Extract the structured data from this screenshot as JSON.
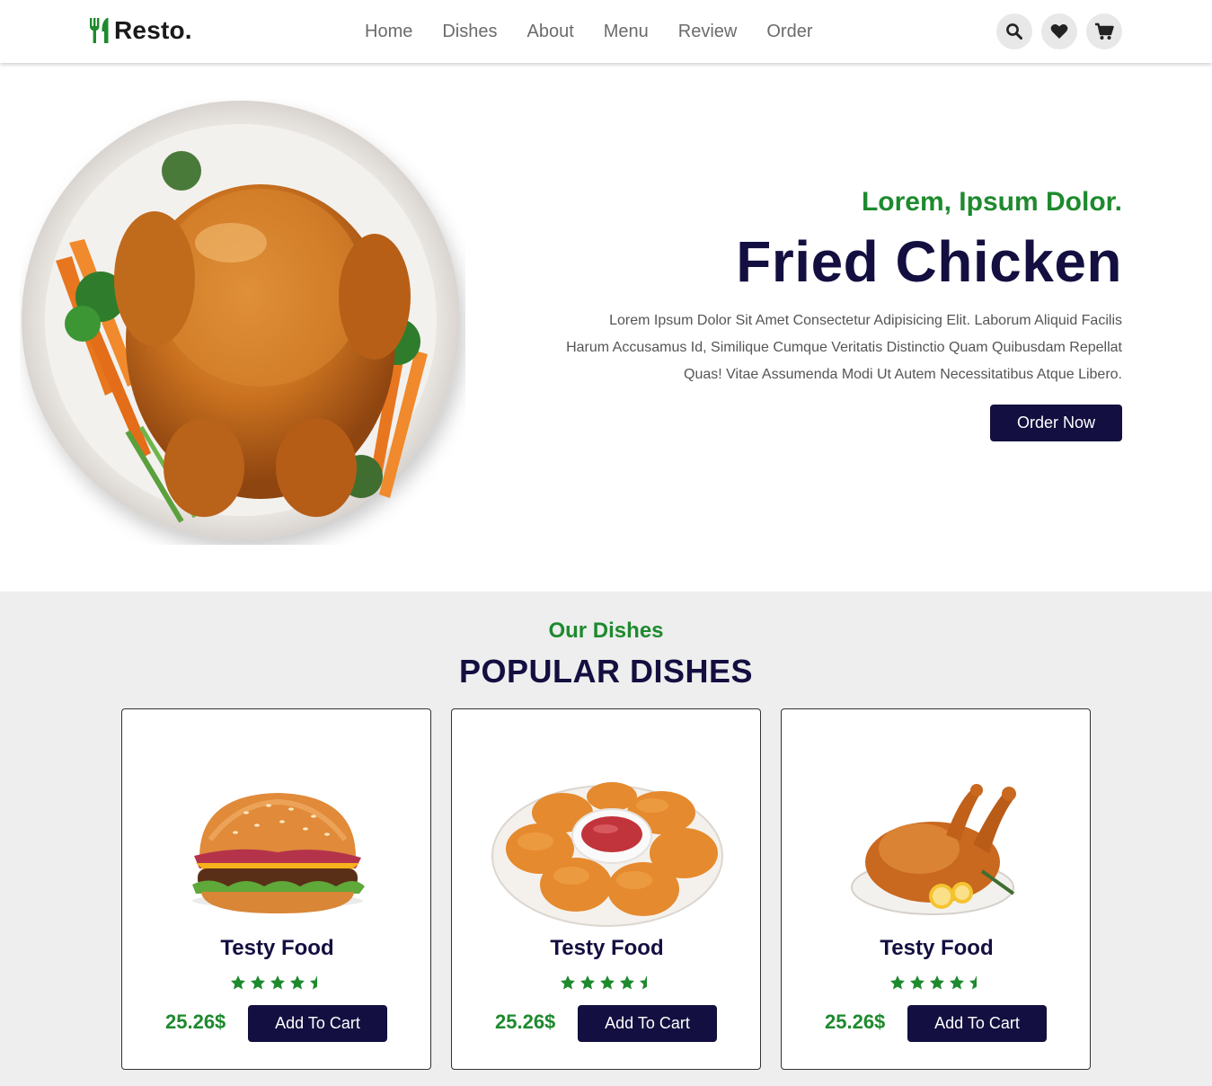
{
  "brand": {
    "name": "Resto.",
    "accent": "#1e8a2e",
    "dark": "#130f40"
  },
  "nav": {
    "items": [
      "Home",
      "Dishes",
      "About",
      "Menu",
      "Review",
      "Order"
    ]
  },
  "header_icons": [
    "search-icon",
    "heart-icon",
    "cart-icon"
  ],
  "hero": {
    "subtitle": "Lorem, Ipsum Dolor.",
    "title": "Fried Chicken",
    "description": "Lorem Ipsum Dolor Sit Amet Consectetur Adipisicing Elit. Laborum Aliquid Facilis Harum Accusamus Id, Similique Cumque Veritatis Distinctio Quam Quibusdam Repellat Quas! Vitae Assumenda Modi Ut Autem Necessitatibus Atque Libero.",
    "button": "Order Now"
  },
  "dishes": {
    "subtitle": "Our Dishes",
    "title": "POPULAR DISHES",
    "cards": [
      {
        "name": "Testy Food",
        "rating": 4.5,
        "price": "25.26$",
        "button": "Add To Cart",
        "image": "burger"
      },
      {
        "name": "Testy Food",
        "rating": 4.5,
        "price": "25.26$",
        "button": "Add To Cart",
        "image": "nuggets"
      },
      {
        "name": "Testy Food",
        "rating": 4.5,
        "price": "25.26$",
        "button": "Add To Cart",
        "image": "roast-chicken"
      }
    ]
  }
}
